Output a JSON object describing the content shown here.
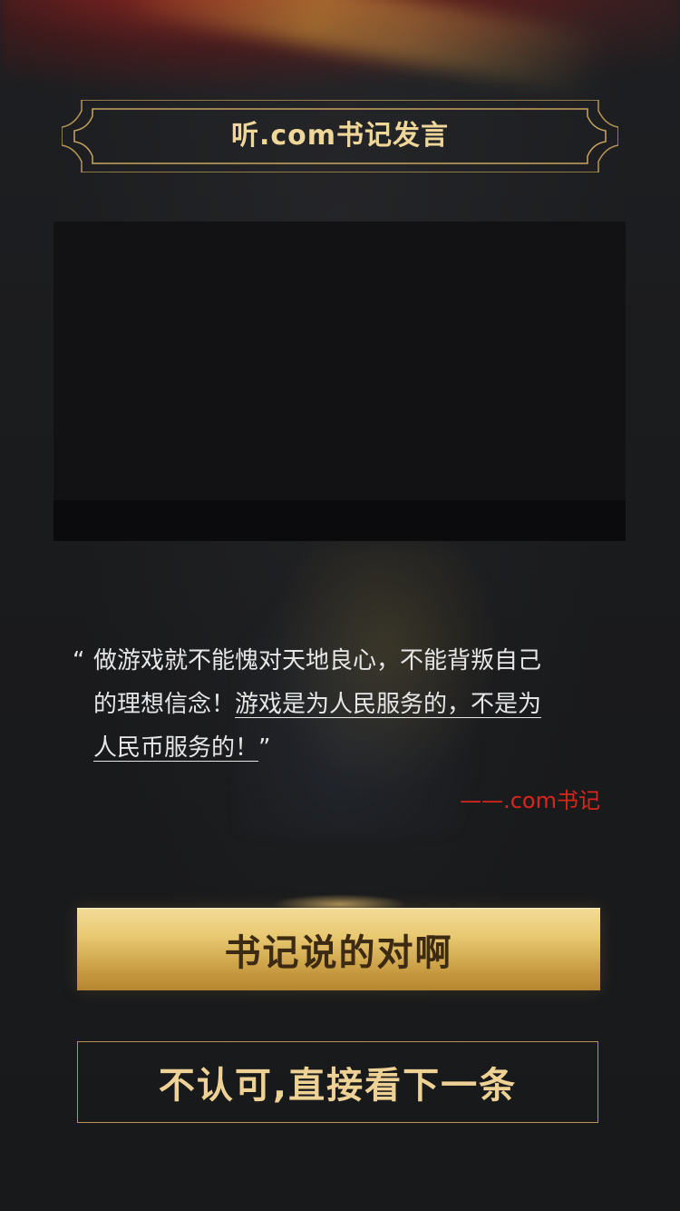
{
  "header": {
    "title": "听.com书记发言"
  },
  "quote": {
    "open_mark": "“",
    "line1": "做游戏就不能愧对天地良心，不能背叛自己",
    "line2_plain": "的理想信念！",
    "line2_underlined": "游戏是为人民服务的，不是为",
    "line3_underlined": "人民币服务的！",
    "close_mark": "”",
    "author": "——.com书记"
  },
  "actions": {
    "agree_label": "书记说的对啊",
    "next_label": "不认可,直接看下一条"
  },
  "colors": {
    "gold": "#efd79a",
    "author_red": "#d9261c",
    "button_gold": "#e8c871"
  }
}
